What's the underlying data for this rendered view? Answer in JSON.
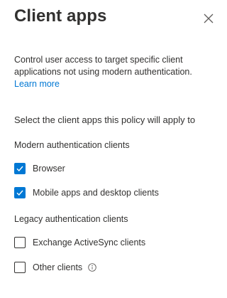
{
  "header": {
    "title": "Client apps",
    "close_icon": "close-icon"
  },
  "description": {
    "text": "Control user access to target specific client applications not using modern authentication.",
    "learn_more": "Learn more"
  },
  "selection": {
    "heading": "Select the client apps this policy will apply to"
  },
  "modern_auth": {
    "label": "Modern authentication clients",
    "items": [
      {
        "label": "Browser",
        "checked": true
      },
      {
        "label": "Mobile apps and desktop clients",
        "checked": true
      }
    ]
  },
  "legacy_auth": {
    "label": "Legacy authentication clients",
    "items": [
      {
        "label": "Exchange ActiveSync clients",
        "checked": false
      },
      {
        "label": "Other clients",
        "checked": false,
        "icon": "info-icon"
      }
    ]
  },
  "colors": {
    "accent": "#0078d4",
    "text": "#323130"
  }
}
